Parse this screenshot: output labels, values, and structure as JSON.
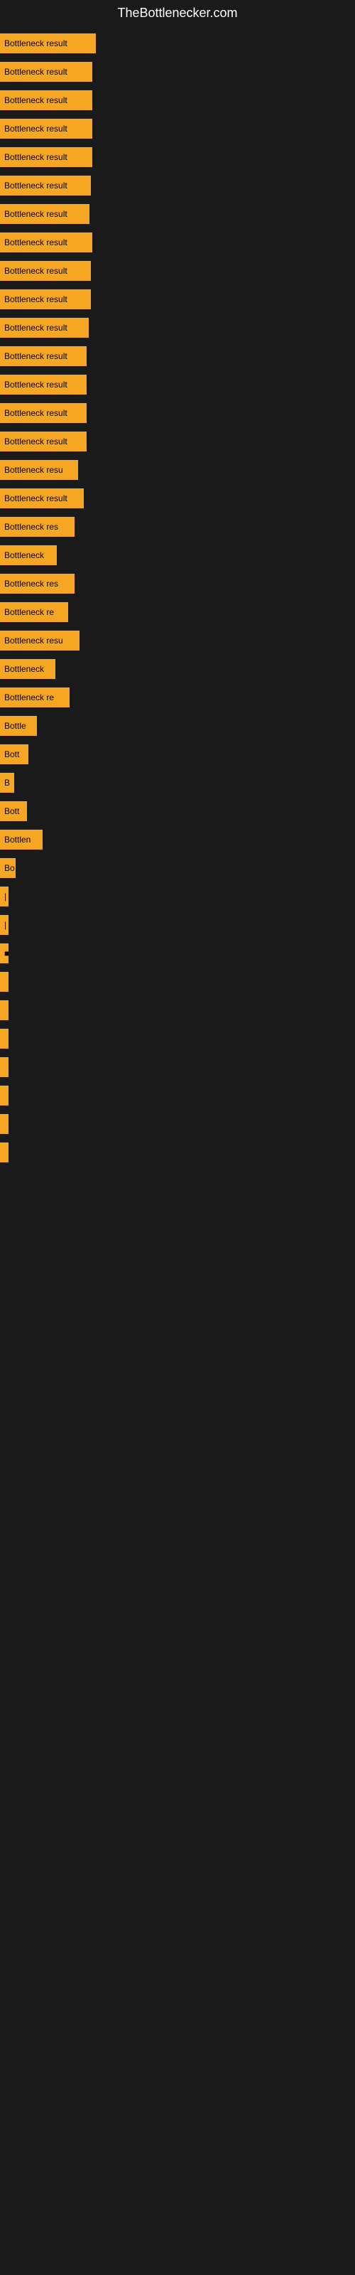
{
  "site": {
    "title": "TheBottlenecker.com"
  },
  "bars": [
    {
      "label": "Bottleneck result",
      "width": 135
    },
    {
      "label": "Bottleneck result",
      "width": 130
    },
    {
      "label": "Bottleneck result",
      "width": 130
    },
    {
      "label": "Bottleneck result",
      "width": 130
    },
    {
      "label": "Bottleneck result",
      "width": 130
    },
    {
      "label": "Bottleneck result",
      "width": 128
    },
    {
      "label": "Bottleneck result",
      "width": 126
    },
    {
      "label": "Bottleneck result",
      "width": 130
    },
    {
      "label": "Bottleneck result",
      "width": 128
    },
    {
      "label": "Bottleneck result",
      "width": 128
    },
    {
      "label": "Bottleneck result",
      "width": 125
    },
    {
      "label": "Bottleneck result",
      "width": 122
    },
    {
      "label": "Bottleneck result",
      "width": 122
    },
    {
      "label": "Bottleneck result",
      "width": 122
    },
    {
      "label": "Bottleneck result",
      "width": 122
    },
    {
      "label": "Bottleneck resu",
      "width": 110
    },
    {
      "label": "Bottleneck result",
      "width": 118
    },
    {
      "label": "Bottleneck res",
      "width": 105
    },
    {
      "label": "Bottleneck",
      "width": 80
    },
    {
      "label": "Bottleneck res",
      "width": 105
    },
    {
      "label": "Bottleneck re",
      "width": 96
    },
    {
      "label": "Bottleneck resu",
      "width": 112
    },
    {
      "label": "Bottleneck",
      "width": 78
    },
    {
      "label": "Bottleneck re",
      "width": 98
    },
    {
      "label": "Bottle",
      "width": 52
    },
    {
      "label": "Bott",
      "width": 40
    },
    {
      "label": "B",
      "width": 20
    },
    {
      "label": "Bott",
      "width": 38
    },
    {
      "label": "Bottlen",
      "width": 60
    },
    {
      "label": "Bo",
      "width": 22
    },
    {
      "label": "|",
      "width": 8
    },
    {
      "label": "|",
      "width": 6
    },
    {
      "label": "■",
      "width": 5
    },
    {
      "label": "",
      "width": 3
    },
    {
      "label": "",
      "width": 3
    },
    {
      "label": "",
      "width": 3
    },
    {
      "label": "",
      "width": 3
    },
    {
      "label": "",
      "width": 3
    },
    {
      "label": "",
      "width": 3
    },
    {
      "label": "",
      "width": 3
    }
  ]
}
